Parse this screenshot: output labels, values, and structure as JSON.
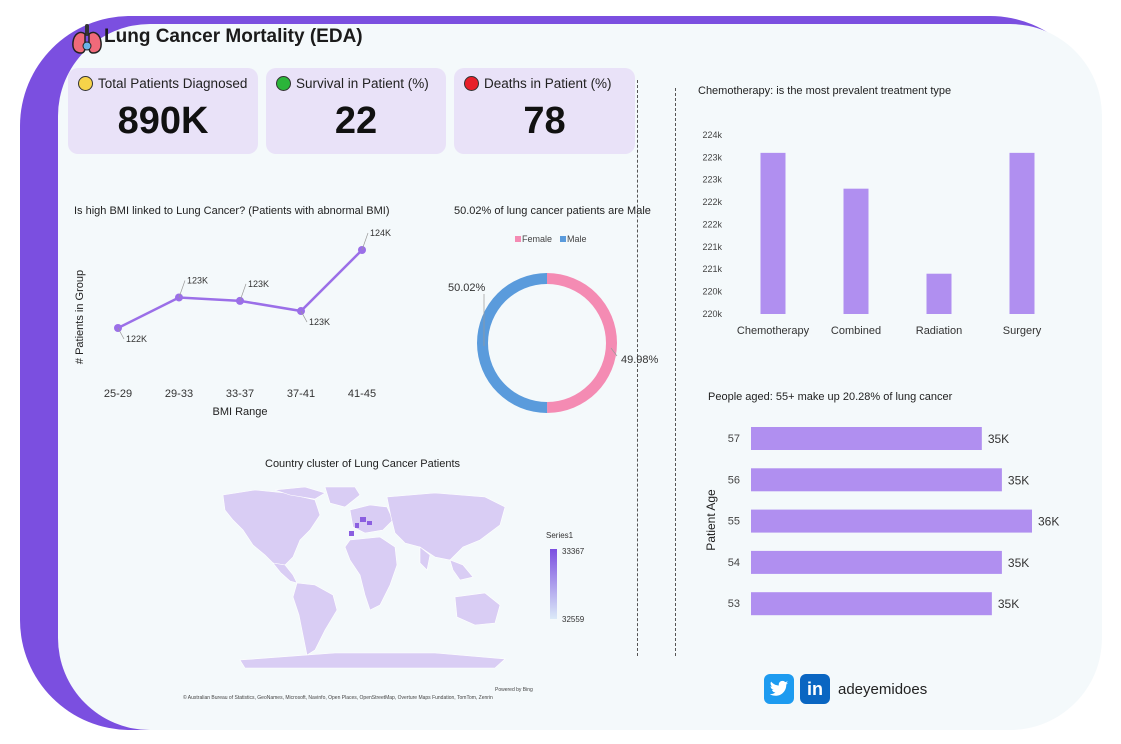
{
  "header": {
    "title": "Lung Cancer Mortality (EDA)"
  },
  "kpis": [
    {
      "label": "Total Patients Diagnosed",
      "value": "890K",
      "icon": "mask-face-icon",
      "color": "#f6d34a"
    },
    {
      "label": "Survival in Patient (%)",
      "value": "22",
      "icon": "green-circle-icon",
      "color": "#2bb53a"
    },
    {
      "label": "Deaths in Patient (%)",
      "value": "78",
      "icon": "red-circle-icon",
      "color": "#e8202a"
    }
  ],
  "bmi": {
    "title": "Is high BMI linked to Lung Cancer? (Patients with abnormal BMI)",
    "ylabel": "# Patients in Group",
    "xlabel": "BMI Range"
  },
  "gender": {
    "title": "50.02% of lung cancer patients are Male",
    "legend_female": "Female",
    "legend_male": "Male"
  },
  "treatment": {
    "title": "Chemotherapy: is the most prevalent treatment type"
  },
  "age": {
    "title": "People aged: 55+ make up 20.28% of lung cancer",
    "ylabel": "Patient Age"
  },
  "map": {
    "title": "Country cluster of Lung Cancer Patients",
    "legend_title": "Series1",
    "legend_max": "33367",
    "legend_min": "32559",
    "powered": "Powered by Bing",
    "credits": "© Australian Bureau of Statistics, GeoNames, Microsoft, Navinfo, Open Places, OpenStreetMap, Overture Maps Fundation, TomTom, Zenrin"
  },
  "social": {
    "handle": "adeyemidoes"
  },
  "colors": {
    "purple": "#7b4fe0",
    "bar": "#b08ff0",
    "line": "#9b6fe8",
    "female": "#f48bb3",
    "male": "#5a9bdc"
  },
  "chart_data": [
    {
      "type": "line",
      "title": "Is high BMI linked to Lung Cancer? (Patients with abnormal BMI)",
      "xlabel": "BMI Range",
      "ylabel": "# Patients in Group",
      "x": [
        "25-29",
        "29-33",
        "33-37",
        "37-41",
        "41-45"
      ],
      "values": [
        122,
        123,
        123,
        123,
        124
      ],
      "plot_values": [
        122.1,
        123.0,
        122.9,
        122.6,
        124.4
      ],
      "labels": [
        "122K",
        "123K",
        "123K",
        "123K",
        "124K"
      ],
      "label_side": [
        "below",
        "above",
        "above",
        "below",
        "above"
      ]
    },
    {
      "type": "pie",
      "title": "50.02% of lung cancer patients are Male",
      "categories": [
        "Female",
        "Male"
      ],
      "values": [
        49.98,
        50.02
      ],
      "labels": [
        "49.98%",
        "50.02%"
      ]
    },
    {
      "type": "bar",
      "title": "Chemotherapy: is the most prevalent treatment type",
      "categories": [
        "Chemotherapy",
        "Combined",
        "Radiation",
        "Surgery"
      ],
      "values": [
        223.4,
        222.6,
        220.7,
        223.4
      ],
      "ylim": [
        219.8,
        224.0
      ],
      "yticks": [
        {
          "v": 219.8,
          "t": "220k"
        },
        {
          "v": 220.3,
          "t": "220k"
        },
        {
          "v": 220.8,
          "t": "221k"
        },
        {
          "v": 221.3,
          "t": "221k"
        },
        {
          "v": 221.8,
          "t": "222k"
        },
        {
          "v": 222.3,
          "t": "222k"
        },
        {
          "v": 222.8,
          "t": "223k"
        },
        {
          "v": 223.3,
          "t": "223k"
        },
        {
          "v": 223.8,
          "t": "224k"
        }
      ]
    },
    {
      "type": "bar",
      "orientation": "horizontal",
      "title": "People aged: 55+ make up 20.28% of lung cancer",
      "ylabel": "Patient Age",
      "categories": [
        "57",
        "56",
        "55",
        "54",
        "53"
      ],
      "values": [
        35.0,
        35.4,
        36.0,
        35.4,
        35.2
      ],
      "labels": [
        "35K",
        "35K",
        "36K",
        "35K",
        "35K"
      ]
    }
  ]
}
